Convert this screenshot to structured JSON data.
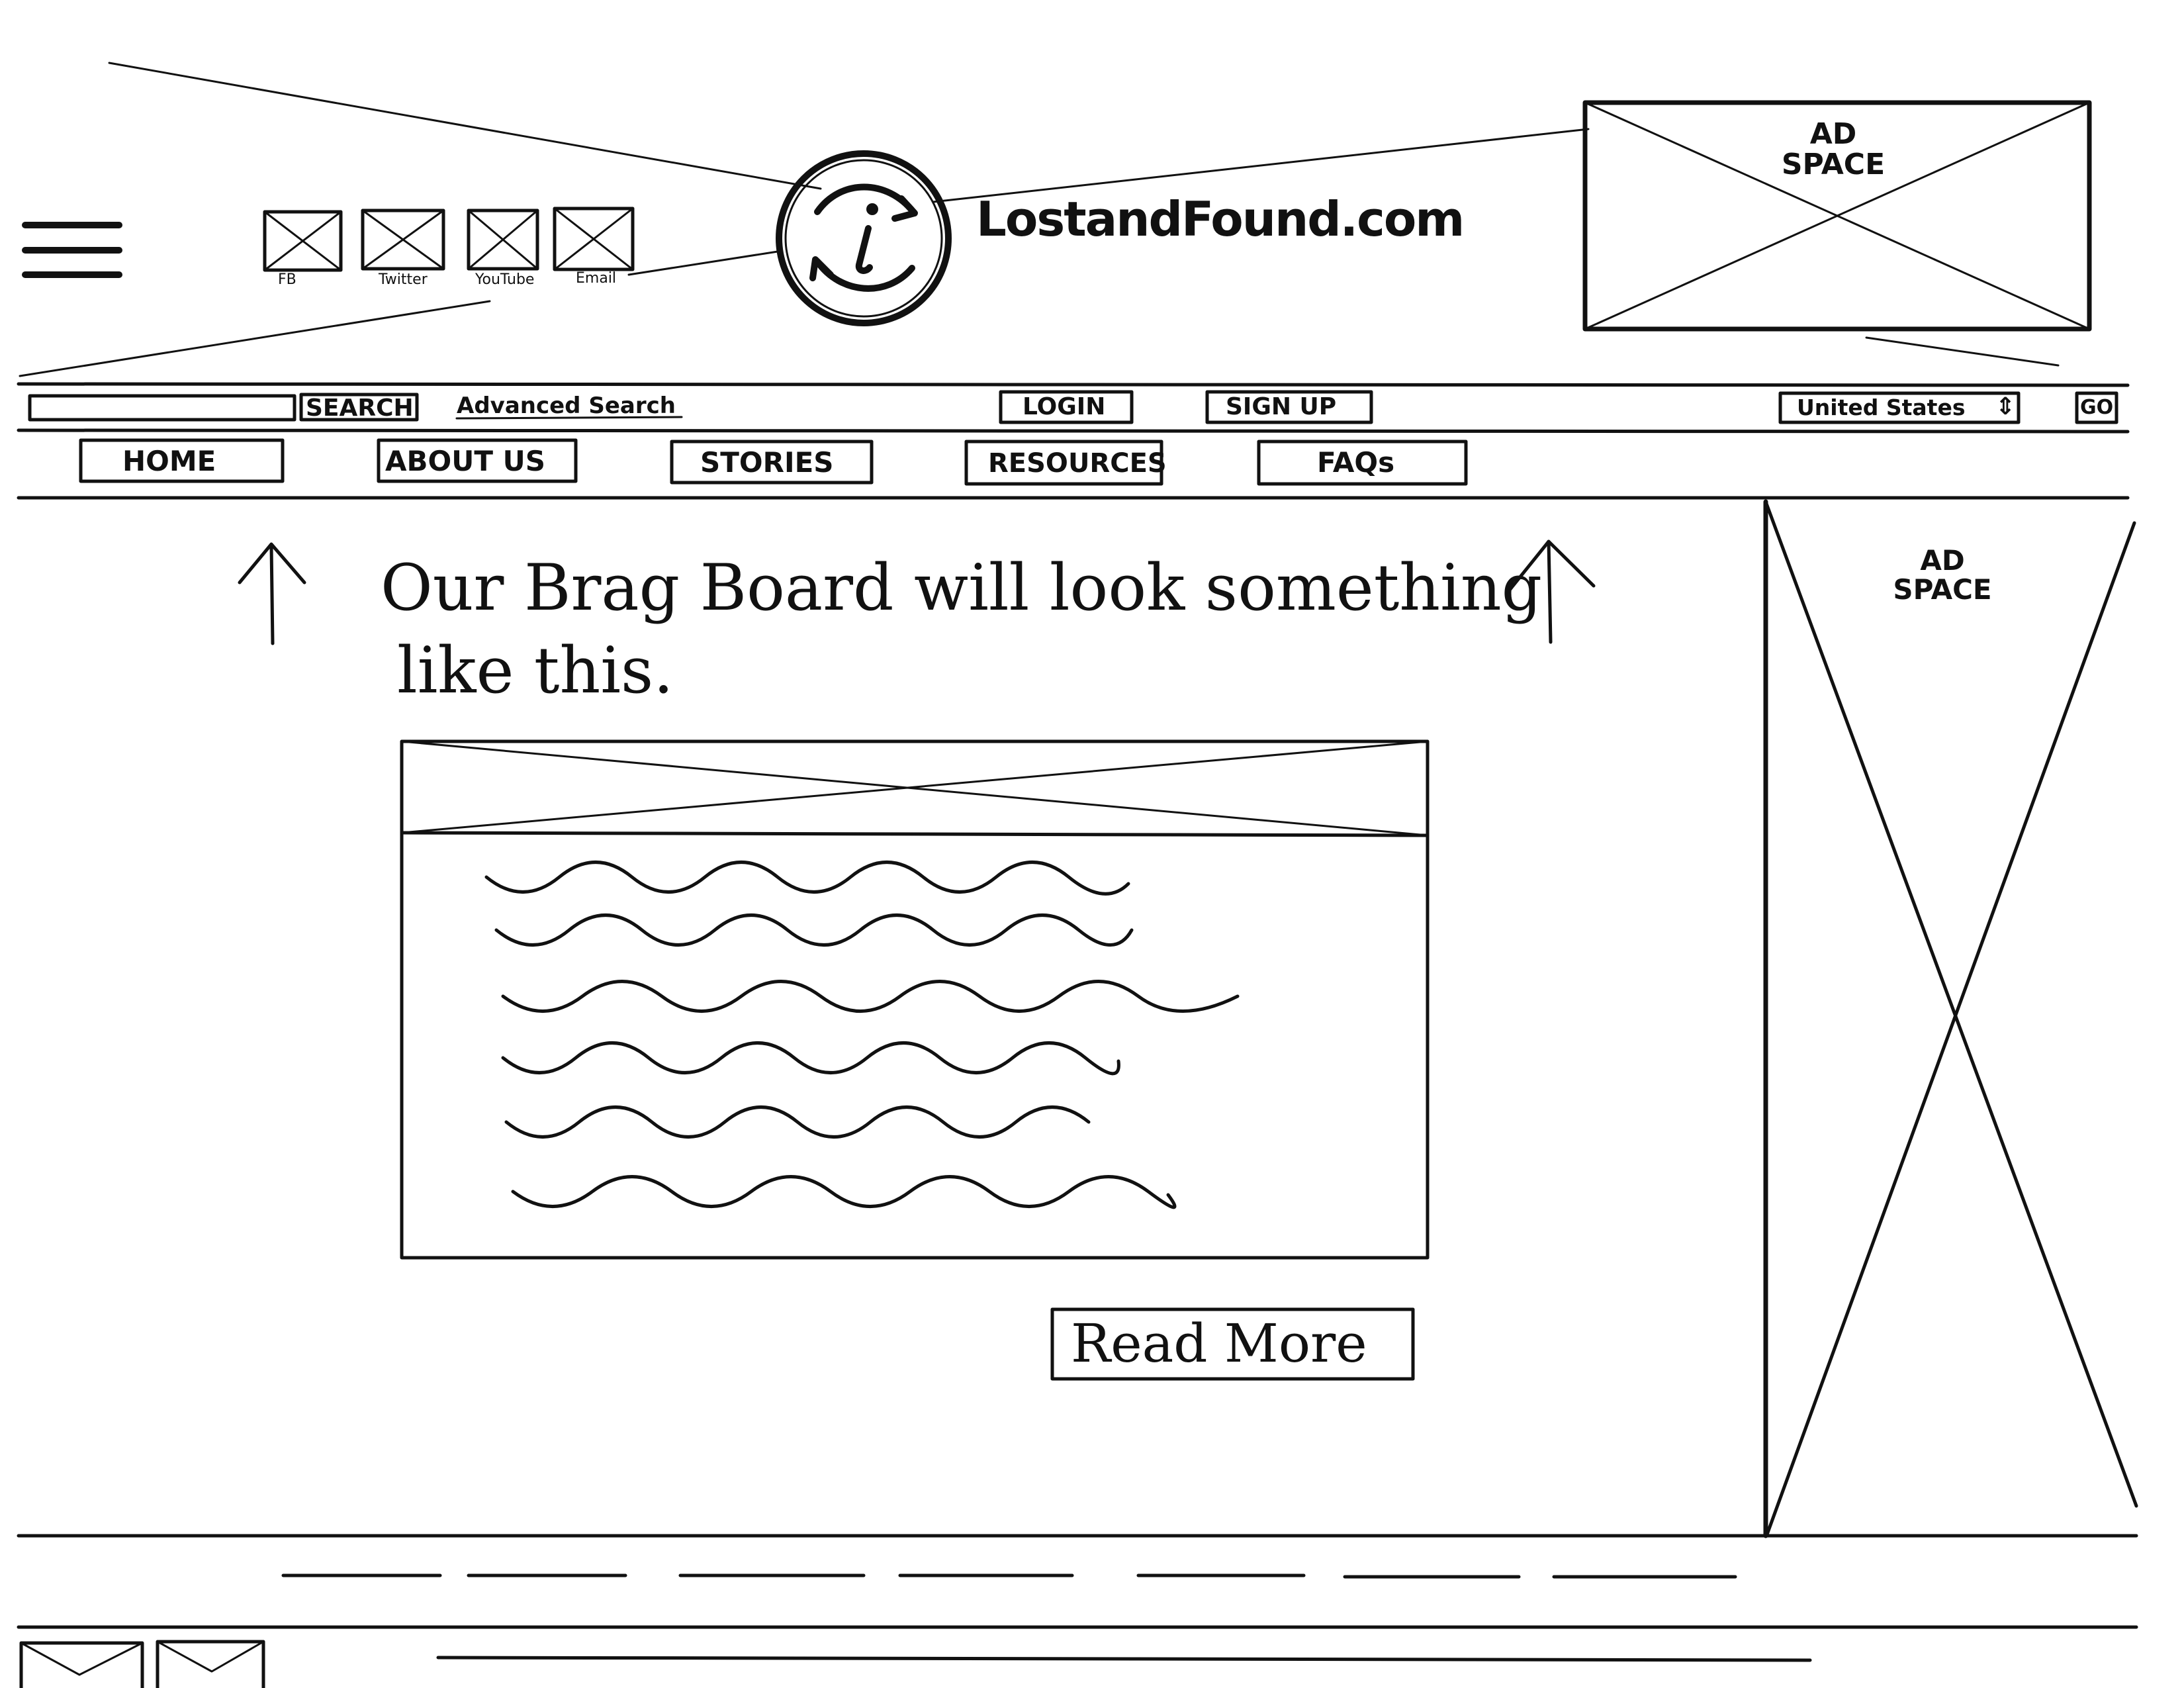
{
  "header": {
    "brand": "LostandFound.com",
    "ad_top": [
      "AD",
      "SPACE"
    ],
    "social": [
      {
        "label": "FB",
        "icon": "facebook-placeholder-icon"
      },
      {
        "label": "Twitter",
        "icon": "twitter-placeholder-icon"
      },
      {
        "label": "YouTube",
        "icon": "youtube-placeholder-icon"
      },
      {
        "label": "Email",
        "icon": "email-placeholder-icon"
      }
    ],
    "menu_icon": "hamburger-menu-icon",
    "logo_icon": "info-refresh-logo-icon"
  },
  "toolbar": {
    "search_value": "",
    "search_button": "SEARCH",
    "advanced_search": "Advanced Search",
    "login": "LOGIN",
    "signup": "SIGN UP",
    "country": "United States",
    "go": "GO"
  },
  "nav": {
    "items": [
      "HOME",
      "ABOUT US",
      "STORIES",
      "RESOURCES",
      "FAQs"
    ]
  },
  "main": {
    "heading_line1": "Our Brag Board will look something",
    "heading_line2": "like this.",
    "read_more": "Read More"
  },
  "sidebar": {
    "ad": [
      "AD",
      "SPACE"
    ]
  },
  "colors": {
    "ink": "#111111",
    "paper": "#ffffff"
  }
}
